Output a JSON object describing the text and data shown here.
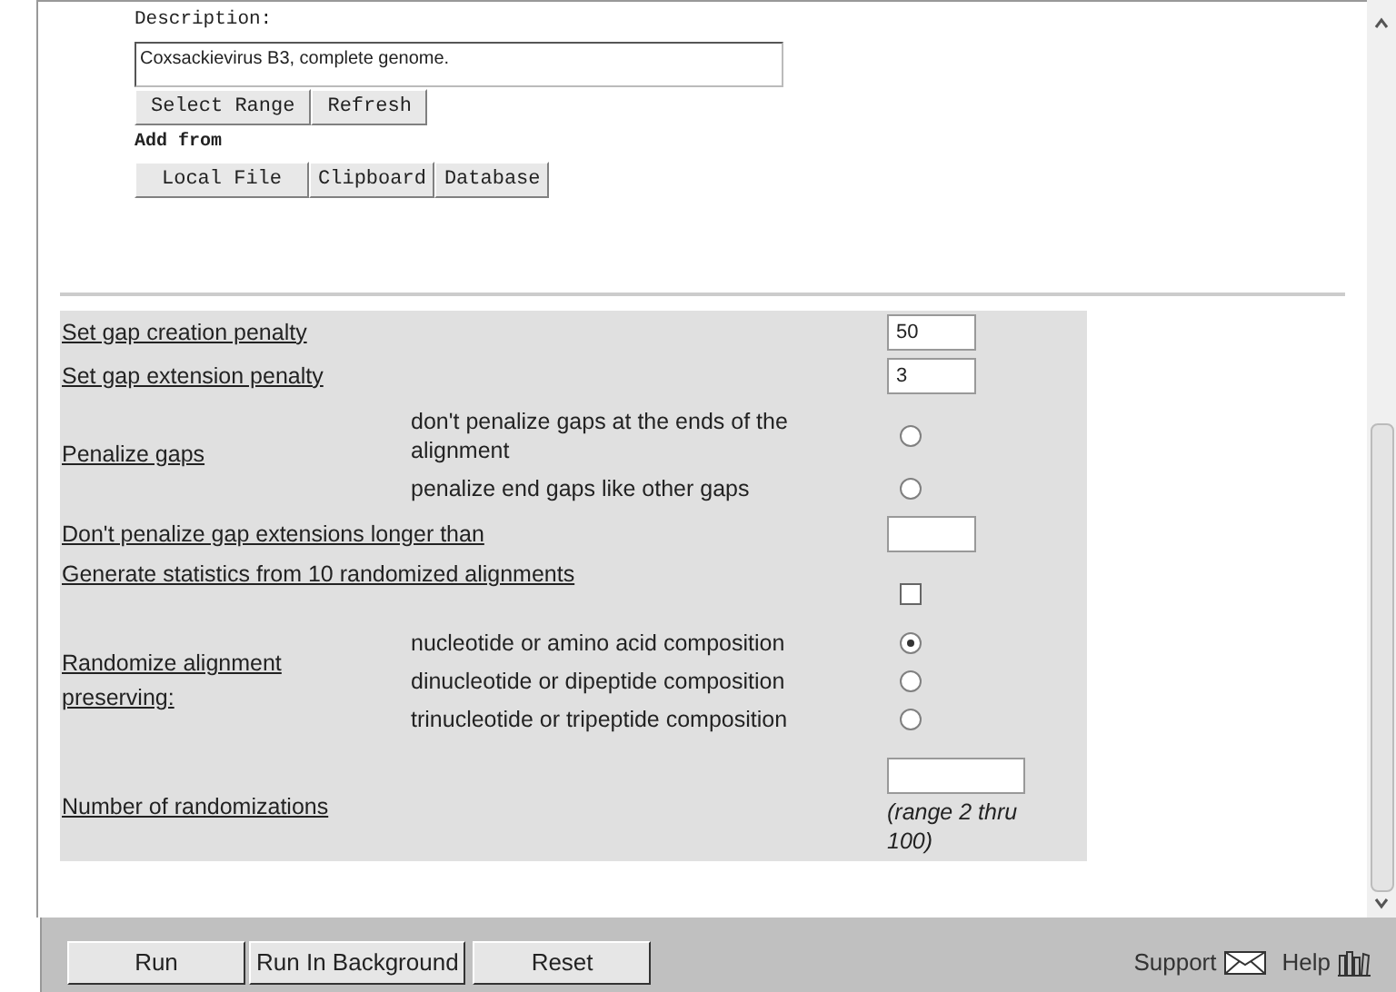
{
  "description": {
    "label": "Description:",
    "value": "Coxsackievirus B3, complete genome."
  },
  "range_buttons": [
    "Select Range",
    "Refresh"
  ],
  "add_from": {
    "label": "Add from",
    "buttons": [
      "Local File",
      "Clipboard",
      "Database"
    ]
  },
  "parameters": [
    {
      "kind": "text",
      "label": "Set gap creation penalty",
      "value": "50"
    },
    {
      "kind": "text",
      "label": "Set gap extension penalty",
      "value": "3"
    },
    {
      "kind": "radio",
      "label": "Penalize gaps",
      "options": [
        {
          "label": "don't penalize gaps at the ends of the alignment",
          "selected": false
        },
        {
          "label": "penalize end gaps like other gaps",
          "selected": false
        }
      ]
    },
    {
      "kind": "text",
      "label": "Don't penalize gap extensions longer than"
    },
    {
      "kind": "checkbox",
      "label": "Generate statistics from 10 randomized alignments",
      "checked": false
    },
    {
      "kind": "radio",
      "label": "Randomize alignment preserving:",
      "options": [
        {
          "label": "nucleotide or amino acid composition",
          "selected": true
        },
        {
          "label": "dinucleotide or dipeptide composition",
          "selected": false
        },
        {
          "label": "trinucleotide or tripeptide composition",
          "selected": false
        }
      ]
    },
    {
      "kind": "note",
      "label": "Number of randomizations",
      "note": "(range 2 thru 100)"
    }
  ],
  "footer": {
    "buttons": [
      "Run",
      "Run In Background",
      "Reset"
    ],
    "links": [
      {
        "kind": "support",
        "label": "Support"
      },
      {
        "kind": "help",
        "label": "Help"
      }
    ]
  }
}
